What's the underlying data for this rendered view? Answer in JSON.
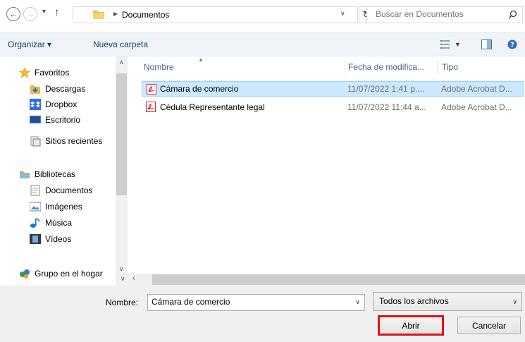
{
  "address": {
    "path_segment": "Documentos",
    "search_placeholder": "Buscar en Documentos"
  },
  "toolbar": {
    "organize_label": "Organizar ▾",
    "new_folder_label": "Nueva carpeta"
  },
  "nav": {
    "favorites": "Favoritos",
    "downloads": "Descargas",
    "dropbox": "Dropbox",
    "desktop": "Escritorio",
    "recent": "Sitios recientes",
    "libraries": "Bibliotecas",
    "documents": "Documentos",
    "images": "Imágenes",
    "music": "Música",
    "videos": "Vídeos",
    "homegroup": "Grupo en el hogar"
  },
  "columns": {
    "name": "Nombre",
    "modified": "Fecha de modifica...",
    "type": "Tipo"
  },
  "files": [
    {
      "name": "Cámara de comercio",
      "modified": "11/07/2022 1:41 p....",
      "type": "Adobe Acrobat D...",
      "selected": true
    },
    {
      "name": "Cédula Representante legal",
      "modified": "11/07/2022 11:44 a...",
      "type": "Adobe Acrobat D...",
      "selected": false
    }
  ],
  "footer": {
    "name_label": "Nombre:",
    "name_value": "Cámara de comercio",
    "filter_value": "Todos los archivos",
    "open_label": "Abrir",
    "cancel_label": "Cancelar"
  },
  "colors": {
    "selection_bg": "#cce8ff",
    "highlight_border": "#e0111b",
    "toolbar_bg": "#f0f4f9"
  }
}
